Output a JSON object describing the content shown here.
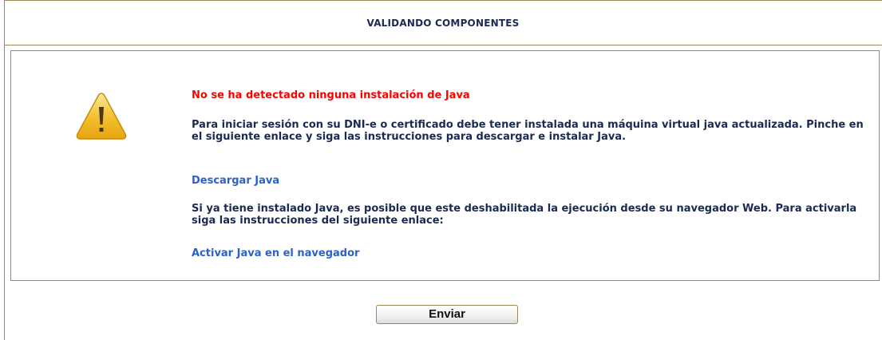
{
  "header": {
    "title": "VALIDANDO COMPONENTES"
  },
  "warning": {
    "icon": "warning-triangle-icon",
    "error_message": "No se ha detectado ninguna instalación de Java",
    "paragraph_1": "Para iniciar sesión con su DNI-e o certificado debe tener instalada una máquina virtual java actualizada. Pinche en el siguiente enlace y siga las instrucciones para descargar e instalar Java.",
    "download_link": "Descargar Java",
    "paragraph_2": "Si ya tiene instalado Java, es posible que este deshabilitada la ejecución desde su navegador Web. Para activarla siga las instrucciones del siguiente enlace:",
    "activate_link": "Activar Java en el navegador"
  },
  "actions": {
    "submit_label": "Enviar"
  },
  "colors": {
    "border": "#a0865a",
    "title_text": "#1b2a52",
    "error_text": "#ff0000",
    "link_text": "#2b62c8",
    "warning_fill": "#f2b51a"
  }
}
